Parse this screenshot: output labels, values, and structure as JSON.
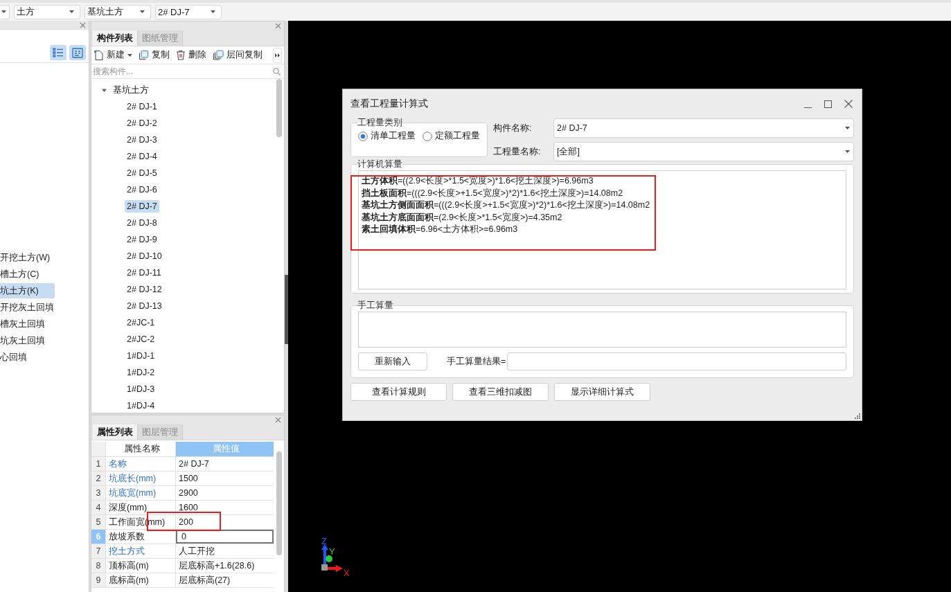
{
  "top_bar": {
    "combos": [
      {
        "value": "土方"
      },
      {
        "value": "基坑土方"
      },
      {
        "value": "2# DJ-7"
      }
    ]
  },
  "left_panel": {
    "view_buttons": [
      {
        "kind": "list",
        "selected": true
      },
      {
        "kind": "detail",
        "selected": true
      }
    ],
    "items": [
      {
        "label": "开挖土方(W)",
        "selected": false
      },
      {
        "label": "槽土方(C)",
        "selected": false
      },
      {
        "label": "坑土方(K)",
        "selected": true
      },
      {
        "label": "开挖灰土回填",
        "selected": false
      },
      {
        "label": "槽灰土回填",
        "selected": false
      },
      {
        "label": "坑灰土回填",
        "selected": false
      },
      {
        "label": "心回填",
        "selected": false
      }
    ]
  },
  "component_panel": {
    "tabs": [
      {
        "label": "构件列表",
        "selected": true
      },
      {
        "label": "图纸管理",
        "selected": false
      }
    ],
    "toolbar": [
      {
        "kind": "new",
        "label": "新建",
        "dropdown": true
      },
      {
        "kind": "copy",
        "label": "复制",
        "dropdown": false
      },
      {
        "kind": "delete",
        "label": "删除",
        "dropdown": false
      },
      {
        "kind": "floor-copy",
        "label": "层间复制",
        "dropdown": false
      }
    ],
    "search": {
      "placeholder": "搜索构件..."
    },
    "tree": [
      {
        "label": "基坑土方",
        "expanded": true,
        "selected": false,
        "children": [
          {
            "label": "2# DJ-1",
            "selected": false
          },
          {
            "label": "2# DJ-2",
            "selected": false
          },
          {
            "label": "2# DJ-3",
            "selected": false
          },
          {
            "label": "2# DJ-4",
            "selected": false
          },
          {
            "label": "2# DJ-5",
            "selected": false
          },
          {
            "label": "2# DJ-6",
            "selected": false
          },
          {
            "label": "2# DJ-7",
            "selected": true
          },
          {
            "label": "2# DJ-8",
            "selected": false
          },
          {
            "label": "2# DJ-9",
            "selected": false
          },
          {
            "label": "2# DJ-10",
            "selected": false
          },
          {
            "label": "2# DJ-11",
            "selected": false
          },
          {
            "label": "2# DJ-12",
            "selected": false
          },
          {
            "label": "2# DJ-13",
            "selected": false
          },
          {
            "label": "2#JC-1",
            "selected": false
          },
          {
            "label": "2#JC-2",
            "selected": false
          },
          {
            "label": "1#DJ-1",
            "selected": false
          },
          {
            "label": "1#DJ-2",
            "selected": false
          },
          {
            "label": "1#DJ-3",
            "selected": false
          },
          {
            "label": "1#DJ-4",
            "selected": false
          }
        ]
      }
    ]
  },
  "property_panel": {
    "tabs": [
      {
        "label": "属性列表",
        "selected": true
      },
      {
        "label": "图层管理",
        "selected": false
      }
    ],
    "columns": [
      "属性名称",
      "属性值"
    ],
    "rows": [
      {
        "no": "1",
        "name": "名称",
        "value": "2# DJ-7",
        "public": true,
        "selected": false
      },
      {
        "no": "2",
        "name": "坑底长(mm)",
        "value": "1500",
        "public": true,
        "selected": false
      },
      {
        "no": "3",
        "name": "坑底宽(mm)",
        "value": "2900",
        "public": true,
        "selected": false
      },
      {
        "no": "4",
        "name": "深度(mm)",
        "value": "1600",
        "public": false,
        "selected": false
      },
      {
        "no": "5",
        "name": "工作面宽(mm)",
        "value": "200",
        "public": false,
        "selected": false
      },
      {
        "no": "6",
        "name": "放坡系数",
        "value": "0",
        "public": false,
        "selected": true
      },
      {
        "no": "7",
        "name": "挖土方式",
        "value": "人工开挖",
        "public": true,
        "selected": false
      },
      {
        "no": "8",
        "name": "顶标高(m)",
        "value": "层底标高+1.6(28.6)",
        "public": false,
        "selected": false
      },
      {
        "no": "9",
        "name": "底标高(m)",
        "value": "层底标高(27)",
        "public": false,
        "selected": false
      }
    ]
  },
  "dialog": {
    "title": "查看工程量计算式",
    "category": {
      "legend": "工程量类别",
      "options": [
        {
          "label": "清单工程量",
          "selected": true
        },
        {
          "label": "定额工程量",
          "selected": false
        }
      ]
    },
    "fields": [
      {
        "label": "构件名称:",
        "value": "2# DJ-7"
      },
      {
        "label": "工程量名称:",
        "value": "[全部]"
      }
    ],
    "computer": {
      "legend": "计算机算量",
      "lines": [
        "**土方体积**=((2.9<长度>*1.5<宽度>)*1.6<挖土深度>)=6.96m3",
        "**挡土板面积**=(((2.9<长度>+1.5<宽度>)*2)*1.6<挖土深度>)=14.08m2",
        "**基坑土方侧面面积**=(((2.9<长度>+1.5<宽度>)*2)*1.6<挖土深度>)=14.08m2",
        "**基坑土方底面面积**=(2.9<长度>*1.5<宽度>)=4.35m2",
        "**素土回填体积**=6.96<土方体积>=6.96m3"
      ]
    },
    "manual": {
      "legend": "手工算量",
      "reset_button": "重新输入",
      "result_label": "手工算量结果="
    },
    "buttons": [
      "查看计算规则",
      "查看三维扣减图",
      "显示详细计算式"
    ]
  },
  "axis_gizmo": {
    "x": "X",
    "y": "Y",
    "z": "Z"
  }
}
